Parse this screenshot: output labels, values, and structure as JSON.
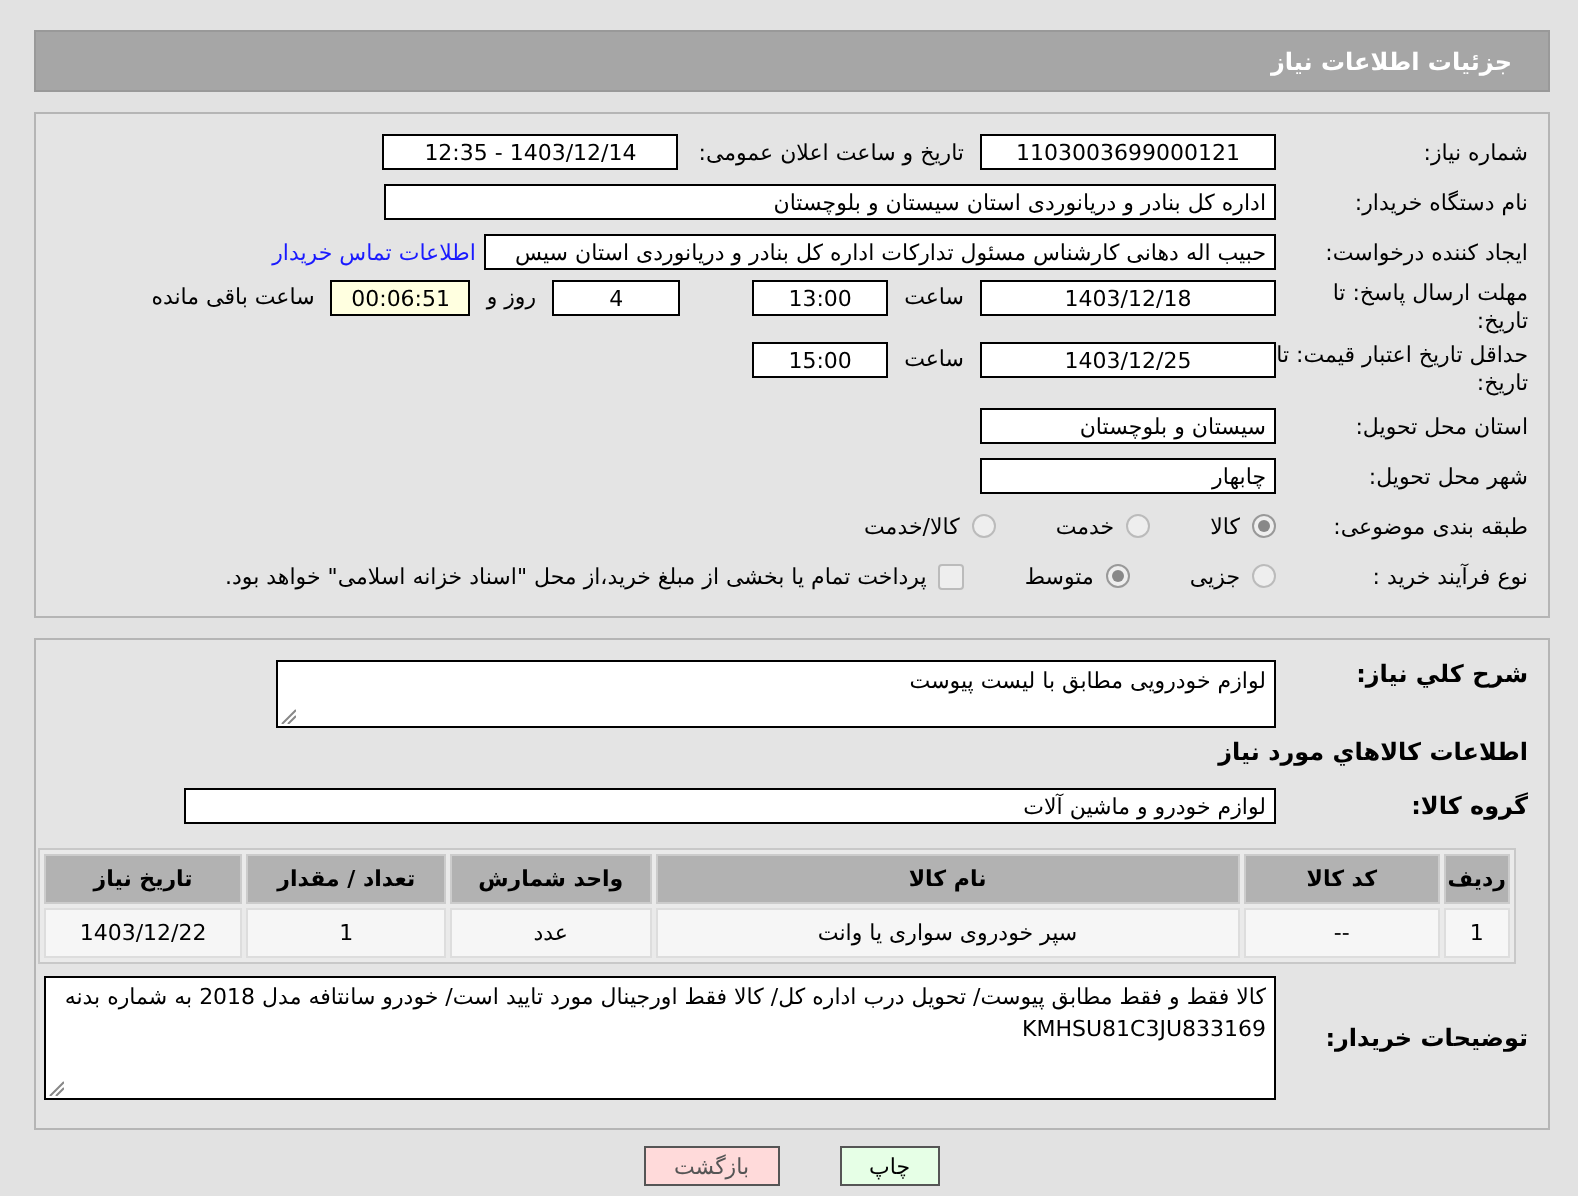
{
  "header": {
    "title": "جزئیات اطلاعات نیاز"
  },
  "need_number": {
    "label": "شماره نیاز:",
    "value": "1103003699000121"
  },
  "announce": {
    "label": "تاریخ و ساعت اعلان عمومی:",
    "value": "1403/12/14 - 12:35"
  },
  "buyer_org": {
    "label": "نام دستگاه خریدار:",
    "value": "اداره کل بنادر و دریانوردی استان سیستان و بلوچستان"
  },
  "requester": {
    "label": "ایجاد کننده درخواست:",
    "value": "حبیب اله دهانی کارشناس مسئول تدارکات اداره کل بنادر و دریانوردی استان سیس",
    "link": "اطلاعات تماس خریدار"
  },
  "reply_deadline": {
    "label": "مهلت ارسال پاسخ: تا تاریخ:",
    "date": "1403/12/18",
    "time_label": "ساعت",
    "time": "13:00",
    "days": "4",
    "days_label": "روز و",
    "remaining": "00:06:51",
    "remaining_label": "ساعت باقی مانده"
  },
  "price_validity": {
    "label": "حداقل تاریخ اعتبار قیمت: تا تاریخ:",
    "date": "1403/12/25",
    "time_label": "ساعت",
    "time": "15:00"
  },
  "province": {
    "label": "استان محل تحویل:",
    "value": "سیستان و بلوچستان"
  },
  "city": {
    "label": "شهر محل تحویل:",
    "value": "چابهار"
  },
  "category": {
    "label": "طبقه بندی موضوعی:",
    "options": [
      {
        "label": "کالا",
        "selected": true
      },
      {
        "label": "خدمت",
        "selected": false
      },
      {
        "label": "کالا/خدمت",
        "selected": false
      }
    ]
  },
  "process": {
    "label": "نوع فرآیند خرید :",
    "options": [
      {
        "label": "جزیی",
        "selected": false
      },
      {
        "label": "متوسط",
        "selected": true
      }
    ],
    "checkbox": {
      "label": "پرداخت تمام یا بخشی از مبلغ خرید،از محل \"اسناد خزانه اسلامی\" خواهد بود.",
      "checked": false
    }
  },
  "description": {
    "label": "شرح کلي نياز:",
    "value": "لوازم خودرویی مطابق با لیست پیوست"
  },
  "goods_title": "اطلاعات کالاهاي مورد نياز",
  "goods_group": {
    "label": "گروه کالا:",
    "value": "لوازم خودرو و ماشین آلات"
  },
  "table": {
    "columns": [
      "ردیف",
      "کد کالا",
      "نام کالا",
      "واحد شمارش",
      "تعداد / مقدار",
      "تاریخ نیاز"
    ],
    "rows": [
      [
        "1",
        "--",
        "سپر خودروی سواری یا وانت",
        "عدد",
        "1",
        "1403/12/22"
      ]
    ]
  },
  "buyer_notes": {
    "label": "توضیحات خریدار:",
    "value": "کالا فقط و فقط مطابق پیوست/ تحویل درب اداره کل/ کالا فقط اورجینال مورد تایید است/       خودرو  سانتافه مدل 2018  به شماره بدنه KMHSU81C3JU833169"
  },
  "buttons": [
    {
      "label": "چاپ",
      "kind": "print"
    },
    {
      "label": "بازگشت",
      "kind": "back"
    }
  ]
}
